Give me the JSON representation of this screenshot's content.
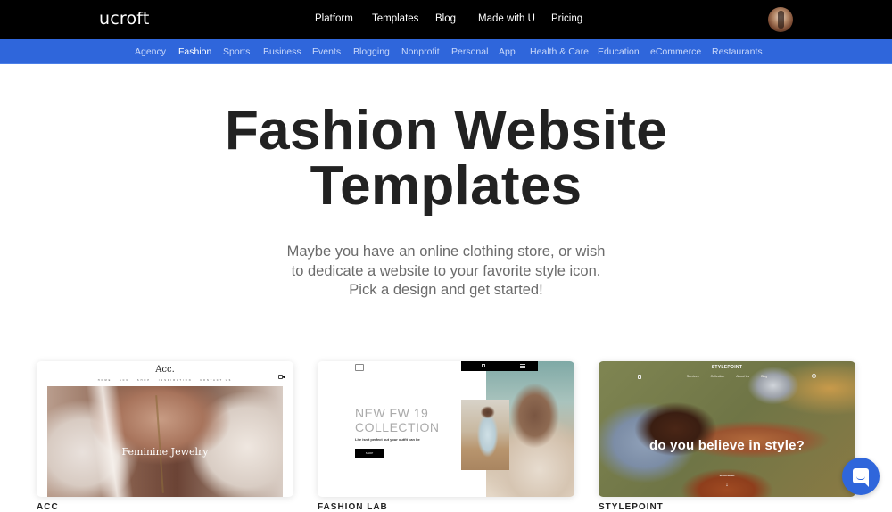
{
  "brand": {
    "logo_text": "ucroft",
    "accent_color": "#2f66db",
    "topbar_color": "#000000"
  },
  "topnav": {
    "items": [
      {
        "label": "Platform"
      },
      {
        "label": "Templates"
      },
      {
        "label": "Blog"
      },
      {
        "label": "Made with U"
      },
      {
        "label": "Pricing"
      }
    ],
    "avatar_icon": "user-avatar"
  },
  "categories": {
    "active": "Fashion",
    "items": [
      {
        "label": "Agency"
      },
      {
        "label": "Fashion"
      },
      {
        "label": "Sports"
      },
      {
        "label": "Business"
      },
      {
        "label": "Events"
      },
      {
        "label": "Blogging"
      },
      {
        "label": "Nonprofit"
      },
      {
        "label": "Personal"
      },
      {
        "label": "App"
      },
      {
        "label": "Health & Care"
      },
      {
        "label": "Education"
      },
      {
        "label": "eCommerce"
      },
      {
        "label": "Restaurants"
      }
    ]
  },
  "hero": {
    "title_line1": "Fashion Website",
    "title_line2": "Templates",
    "subtitle_line1": "Maybe you have an online clothing store, or wish",
    "subtitle_line2": "to dedicate a website to your favorite style icon.",
    "subtitle_line3": "Pick a design and get started!"
  },
  "templates": [
    {
      "name": "ACC",
      "preview": {
        "logo": "Acc.",
        "nav": [
          "HOME",
          "ACC",
          "SHOP",
          "INSPIRATION",
          "CONTACT US"
        ],
        "headline": "Feminine Jewelry"
      }
    },
    {
      "name": "FASHION LAB",
      "preview": {
        "headline_line1": "NEW FW 19",
        "headline_line2": "COLLECTION",
        "tagline": "Life isn't perfect but your outfit can be",
        "button": "SHOP"
      }
    },
    {
      "name": "STYLEPOINT",
      "preview": {
        "logo": "STYLEPOINT",
        "nav": [
          "Services",
          "Collection",
          "About Us",
          "Blog"
        ],
        "headline": "do you believe in style?",
        "scroll_label": "scroll down",
        "scroll_arrow": "↓"
      }
    }
  ],
  "chat_widget": {
    "icon": "chat-icon"
  }
}
